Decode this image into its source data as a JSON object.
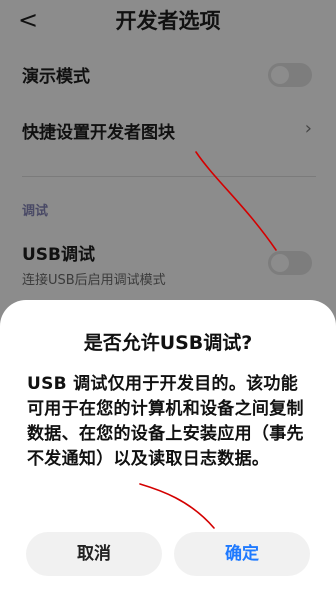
{
  "header": {
    "back_glyph": "<",
    "title": "开发者选项"
  },
  "settings": {
    "demo_mode": {
      "label": "演示模式",
      "enabled": false
    },
    "quick_tiles": {
      "label": "快捷设置开发者图块",
      "chevron": "›"
    },
    "section_debug": "调试",
    "usb_debug": {
      "label": "USB调试",
      "sub": "连接USB后启用调试模式",
      "enabled": false
    }
  },
  "dialog": {
    "title": "是否允许USB调试?",
    "body": "USB 调试仅用于开发目的。该功能可用于在您的计算机和设备之间复制数据、在您的设备上安装应用（事先不发通知）以及读取日志数据。",
    "cancel": "取消",
    "confirm": "确定"
  },
  "colors": {
    "accent": "#1f7aff",
    "annotation": "#d40000"
  }
}
